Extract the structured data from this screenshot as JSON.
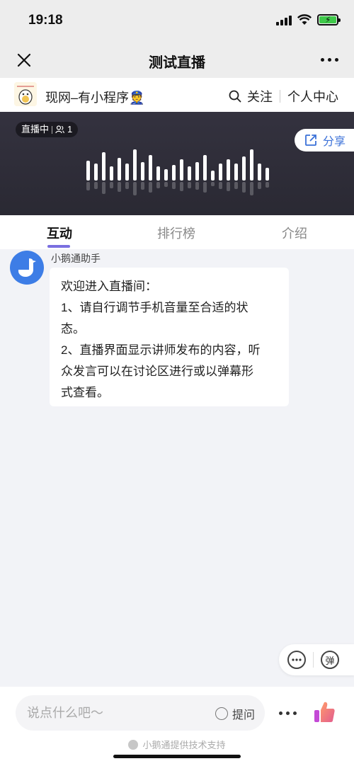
{
  "status_bar": {
    "time": "19:18"
  },
  "nav": {
    "title": "测试直播"
  },
  "channel": {
    "name": "现网–有小程序👮",
    "follow": "关注",
    "personal_center": "个人中心"
  },
  "live": {
    "status": "直播中",
    "viewers": "1",
    "share": "分享"
  },
  "tabs": [
    {
      "label": "互动",
      "active": true
    },
    {
      "label": "排行榜",
      "active": false
    },
    {
      "label": "介绍",
      "active": false
    }
  ],
  "message": {
    "sender": "小鹅通助手",
    "lines": [
      "欢迎进入直播间：",
      "1、请自行调节手机音量至合适的状",
      "态。",
      "2、直播界面显示讲师发布的内容，听",
      "众发言可以在讨论区进行或以弹幕形",
      "式查看。"
    ]
  },
  "float_actions": {
    "danmaku": "弹"
  },
  "input": {
    "placeholder": "说点什么吧～",
    "ask_label": "提问"
  },
  "footer": {
    "note": "小鹅通提供技术支持"
  },
  "colors": {
    "accent": "#7a6fe0",
    "share": "#3a70d8",
    "avatar": "#3d7de6",
    "banner": "#2f2d38"
  }
}
